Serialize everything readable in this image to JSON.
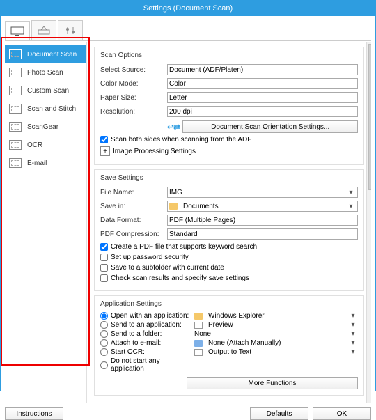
{
  "title": "Settings (Document Scan)",
  "tabs": [
    {
      "name": "scan-tab"
    },
    {
      "name": "save-tab"
    },
    {
      "name": "prefs-tab"
    }
  ],
  "sidebar": {
    "items": [
      {
        "label": "Document Scan"
      },
      {
        "label": "Photo Scan"
      },
      {
        "label": "Custom Scan"
      },
      {
        "label": "Scan and Stitch"
      },
      {
        "label": "ScanGear"
      },
      {
        "label": "OCR"
      },
      {
        "label": "E-mail"
      }
    ]
  },
  "scanOptions": {
    "heading": "Scan Options",
    "selectSourceLabel": "Select Source:",
    "selectSource": "Document (ADF/Platen)",
    "colorModeLabel": "Color Mode:",
    "colorMode": "Color",
    "paperSizeLabel": "Paper Size:",
    "paperSize": "Letter",
    "resolutionLabel": "Resolution:",
    "resolution": "200 dpi",
    "orientationBtn": "Document Scan Orientation Settings...",
    "scanBothLabel": "Scan both sides when scanning from the ADF",
    "imageProcLabel": "Image Processing Settings"
  },
  "saveSettings": {
    "heading": "Save Settings",
    "fileNameLabel": "File Name:",
    "fileName": "IMG",
    "saveInLabel": "Save in:",
    "saveIn": "Documents",
    "dataFormatLabel": "Data Format:",
    "dataFormat": "PDF (Multiple Pages)",
    "pdfCompLabel": "PDF Compression:",
    "pdfComp": "Standard",
    "cb1": "Create a PDF file that supports keyword search",
    "cb2": "Set up password security",
    "cb3": "Save to a subfolder with current date",
    "cb4": "Check scan results and specify save settings"
  },
  "appSettings": {
    "heading": "Application Settings",
    "r1": "Open with an application:",
    "r1v": "Windows Explorer",
    "r2": "Send to an application:",
    "r2v": "Preview",
    "r3": "Send to a folder:",
    "r3v": "None",
    "r4": "Attach to e-mail:",
    "r4v": "None (Attach Manually)",
    "r5": "Start OCR:",
    "r5v": "Output to Text",
    "r6": "Do not start any application",
    "moreBtn": "More Functions"
  },
  "footer": {
    "instructions": "Instructions",
    "defaults": "Defaults",
    "ok": "OK"
  }
}
